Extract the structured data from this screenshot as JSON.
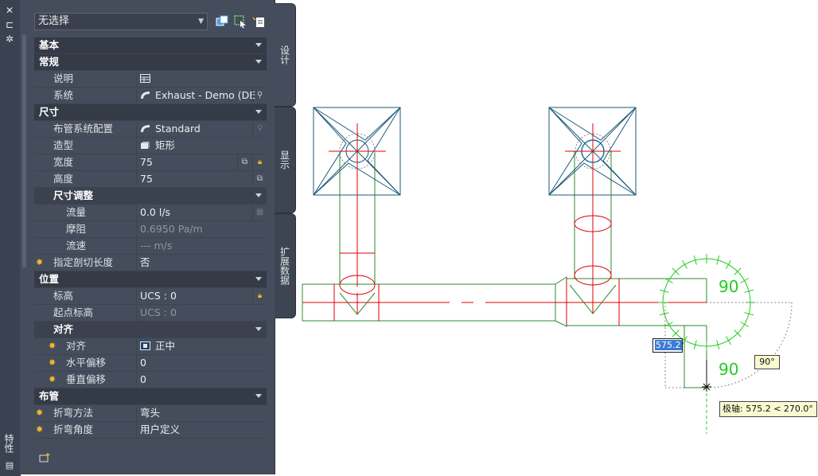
{
  "panel": {
    "title": "特性",
    "selection": "无选择",
    "tabs": [
      "设计",
      "显示",
      "扩展数据"
    ]
  },
  "groups": {
    "basic": "基本",
    "general": {
      "label": "常规",
      "description": {
        "name": "说明",
        "value": ""
      },
      "system": {
        "name": "系统",
        "value": "Exhaust - Demo (DE"
      }
    },
    "dimensions": {
      "label": "尺寸",
      "routing_pref": {
        "name": "布管系统配置",
        "value": "Standard"
      },
      "shape": {
        "name": "造型",
        "value": "矩形"
      },
      "width": {
        "name": "宽度",
        "value": "75"
      },
      "height": {
        "name": "高度",
        "value": "75"
      },
      "sizing": {
        "label": "尺寸调整",
        "flow": {
          "name": "流量",
          "value": "0.0 l/s"
        },
        "friction": {
          "name": "摩阻",
          "value": "0.6950 Pa/m"
        },
        "velocity": {
          "name": "流速",
          "value": "--- m/s"
        }
      },
      "cut_length": {
        "name": "指定剖切长度",
        "value": "否"
      }
    },
    "location": {
      "label": "位置",
      "elevation": {
        "name": "标高",
        "value": "UCS : 0"
      },
      "start_elevation": {
        "name": "起点标高",
        "value": "UCS : 0"
      },
      "alignment": {
        "label": "对齐",
        "justify": {
          "name": "对齐",
          "value": "正中"
        },
        "h_offset": {
          "name": "水平偏移",
          "value": "0"
        },
        "v_offset": {
          "name": "垂直偏移",
          "value": "0"
        }
      }
    },
    "routing": {
      "label": "布管",
      "bend_method": {
        "name": "折弯方法",
        "value": "弯头"
      },
      "bend_angle": {
        "name": "折弯角度",
        "value": "用户定义"
      }
    }
  },
  "canvas": {
    "dynamic_input": "575.2",
    "angle_tip": "90°",
    "polar_tip": "极轴: 575.2 < 270.0°",
    "protractor_labels": [
      "90",
      "90"
    ]
  },
  "colors": {
    "panel_bg": "#454c5b",
    "header_bg": "#343a46",
    "star": "#f3b62a",
    "duct_green": "#2e8b2e",
    "centerline_red": "#e00000",
    "grille_blue": "#1d5a78",
    "protractor_green": "#22cc22"
  }
}
